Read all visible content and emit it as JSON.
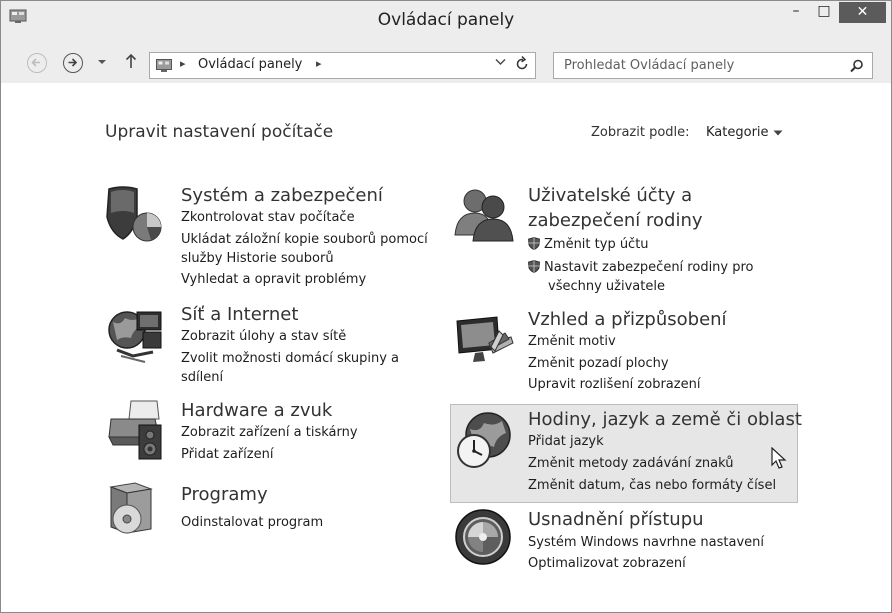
{
  "window": {
    "title": "Ovládací panely",
    "minimize": "–",
    "maximize": "□",
    "close": "✕"
  },
  "address": {
    "path": "Ovládací panely",
    "separator": "▸",
    "search_placeholder": "Prohledat Ovládací panely"
  },
  "header": {
    "heading": "Upravit nastavení počítače",
    "view_by_label": "Zobrazit podle:",
    "view_by_value": "Kategorie"
  },
  "categories": {
    "system": {
      "title": "Systém a zabezpečení",
      "link1": "Zkontrolovat stav počítače",
      "link2": "Ukládat záložní kopie souborů pomocí",
      "link2b": "služby Historie souborů",
      "link3": "Vyhledat a opravit problémy"
    },
    "network": {
      "title": "Síť a Internet",
      "link1": "Zobrazit úlohy a stav sítě",
      "link2": "Zvolit možnosti domácí skupiny a",
      "link2b": "sdílení"
    },
    "hardware": {
      "title": "Hardware a zvuk",
      "link1": "Zobrazit zařízení a tiskárny",
      "link2": "Přidat zařízení"
    },
    "programs": {
      "title": "Programy",
      "link1": "Odinstalovat program"
    },
    "users": {
      "title1": "Uživatelské účty a",
      "title2": "zabezpečení rodiny",
      "link1": "Změnit typ účtu",
      "link2": "Nastavit zabezpečení rodiny pro",
      "link2b": "všechny uživatele"
    },
    "appearance": {
      "title": "Vzhled a přizpůsobení",
      "link1": "Změnit motiv",
      "link2": "Změnit pozadí plochy",
      "link3": "Upravit rozlišení zobrazení"
    },
    "clock": {
      "title": "Hodiny, jazyk a země či oblast",
      "link1": "Přidat jazyk",
      "link2": "Změnit metody zadávání znaků",
      "link3": "Změnit datum, čas nebo formáty čísel"
    },
    "ease": {
      "title": "Usnadnění přístupu",
      "link1": "Systém Windows navrhne nastavení",
      "link2": "Optimalizovat zobrazení"
    }
  }
}
